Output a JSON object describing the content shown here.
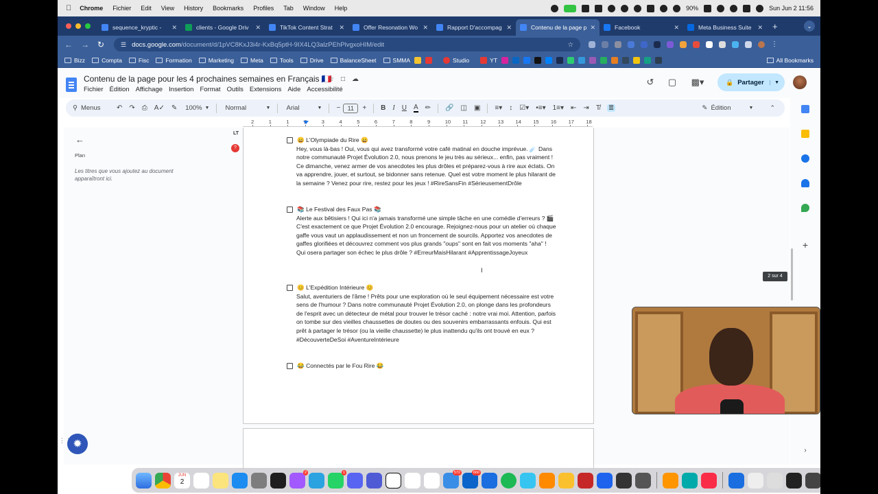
{
  "menubar": {
    "app": "Chrome",
    "items": [
      "Fichier",
      "Edit",
      "View",
      "History",
      "Bookmarks",
      "Profiles",
      "Tab",
      "Window",
      "Help"
    ],
    "battery": "90%",
    "datetime": "Sun Jun 2  11:56"
  },
  "tabs": [
    {
      "title": "sequence_kryptic - ",
      "color": "#4285f4",
      "active": false
    },
    {
      "title": "clients - Google Driv",
      "color": "#0f9d58",
      "active": false
    },
    {
      "title": "TikTok Content Strat",
      "color": "#4285f4",
      "active": false
    },
    {
      "title": "Offer Resonation Wo",
      "color": "#4285f4",
      "active": false
    },
    {
      "title": "Rapport D'accompag",
      "color": "#4285f4",
      "active": false
    },
    {
      "title": "Contenu de la page p",
      "color": "#4285f4",
      "active": true
    },
    {
      "title": "Facebook",
      "color": "#1877f2",
      "active": false
    },
    {
      "title": "Meta Business Suite",
      "color": "#0668e1",
      "active": false
    }
  ],
  "address": {
    "host": "docs.google.com",
    "path": "/document/d/1pVC8KxJ3i4r-KxBq5ptH-9IX4LQ3alzPEhPlvgxoHIM/edit"
  },
  "bookmarks": [
    "Bizz",
    "Compta",
    "Fisc",
    "Formation",
    "Marketing",
    "Meta",
    "Tools",
    "Drive",
    "BalanceSheet",
    "SMMA",
    "Studio",
    "YT"
  ],
  "all_bookmarks": "All Bookmarks",
  "doc": {
    "title": "Contenu de la page pour les 4 prochaines semaines en Français 🇫🇷",
    "menu": [
      "Fichier",
      "Édition",
      "Affichage",
      "Insertion",
      "Format",
      "Outils",
      "Extensions",
      "Aide",
      "Accessibilité"
    ],
    "share_label": "Partager"
  },
  "toolbar": {
    "menus_label": "Menus",
    "zoom": "100%",
    "style": "Normal",
    "font": "Arial",
    "font_size": "11",
    "mode": "Édition"
  },
  "outline": {
    "label": "Plan",
    "hint": "Les titres que vous ajoutez au document apparaîtront ici."
  },
  "ruler": [
    "2",
    "1",
    "1",
    "2",
    "3",
    "4",
    "5",
    "6",
    "7",
    "8",
    "9",
    "10",
    "11",
    "12",
    "13",
    "14",
    "15",
    "16",
    "17",
    "18"
  ],
  "sections": [
    {
      "title": "😄 L'Olympiade du Rire 😄",
      "body": "Hey, vous là-bas ! Oui, vous qui avez transformé votre café matinal en douche imprévue. ☄️ Dans notre communauté Projet Évolution 2.0, nous prenons le jeu très au sérieux... enfin, pas vraiment ! Ce dimanche, venez armer de vos anecdotes les plus drôles et préparez-vous à rire aux éclats. On va apprendre, jouer, et surtout, se bidonner sans retenue. Quel est votre moment le plus hilarant de la semaine ? Venez pour rire, restez pour les jeux ! #RireSansFin #SérieusementDrôle"
    },
    {
      "title": "📚 Le Festival des Faux Pas 📚",
      "body": "Alerte aux bêtisiers ! Qui ici n'a jamais transformé une simple tâche en une comédie d'erreurs ? 🎬 C'est exactement ce que Projet Évolution 2.0 encourage. Rejoignez-nous pour un atelier où chaque gaffe vous vaut un applaudissement et non un froncement de sourcils. Apportez vos anecdotes de gaffes glorifiées et découvrez comment vos plus grands \"oups\" sont en fait vos moments \"aha\" ! Qui osera partager son échec le plus drôle ? #ErreurMaisHilarant #ApprentissageJoyeux"
    },
    {
      "title": "😊 L'Expédition Intérieure 😊",
      "body": "Salut, aventuriers de l'âme ! Prêts pour une exploration où le seul équipement nécessaire est votre sens de l'humour ? Dans notre communauté Projet Évolution 2.0, on plonge dans les profondeurs de l'esprit avec un détecteur de métal pour trouver le trésor caché : notre vrai moi. Attention, parfois on tombe sur des vieilles chaussettes de doutes ou des souvenirs embarrassants enfouis. Qui est prêt à partager le trésor (ou la vieille chaussette) le plus inattendu qu'ils ont trouvé en eux ? #DécouverteDeSoi #AventureIntérieure"
    },
    {
      "title": "😂 Connectés par le Fou Rire 😂",
      "body": ""
    }
  ],
  "page_indicator": "2 sur 4",
  "dock": {
    "calendar_month": "JUN",
    "calendar_day": "2",
    "badges": {
      "messenger": "2",
      "whatsapp": "1",
      "mail": "572",
      "outlook": "660"
    }
  }
}
